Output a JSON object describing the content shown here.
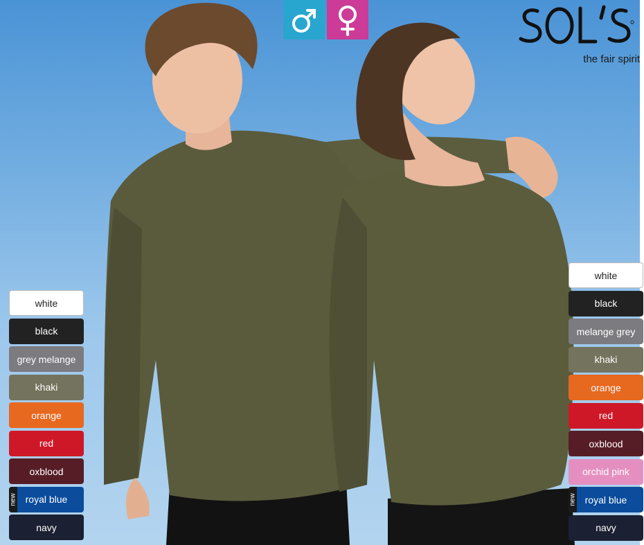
{
  "brand": {
    "logo_text": "SOL'S",
    "tagline": "the fair spirit"
  },
  "gender_icons": [
    {
      "name": "male",
      "icon": "male-symbol-icon",
      "color": "#29a6cf"
    },
    {
      "name": "female",
      "icon": "female-symbol-icon",
      "color": "#cb3b97"
    }
  ],
  "men_colors": [
    {
      "label": "white",
      "hex": "#ffffff",
      "light": true
    },
    {
      "label": "black",
      "hex": "#222222"
    },
    {
      "label": "grey melange",
      "hex": "#7c7b80"
    },
    {
      "label": "khaki",
      "hex": "#74735e"
    },
    {
      "label": "orange",
      "hex": "#e7681f"
    },
    {
      "label": "red",
      "hex": "#cf1827"
    },
    {
      "label": "oxblood",
      "hex": "#571d26"
    },
    {
      "label": "royal blue",
      "hex": "#0b4c9c",
      "new": true,
      "new_label": "new"
    },
    {
      "label": "navy",
      "hex": "#1c2033"
    }
  ],
  "women_colors": [
    {
      "label": "white",
      "hex": "#ffffff",
      "light": true
    },
    {
      "label": "black",
      "hex": "#222222"
    },
    {
      "label": "melange grey",
      "hex": "#7c7b80"
    },
    {
      "label": "khaki",
      "hex": "#74735e"
    },
    {
      "label": "orange",
      "hex": "#e7681f"
    },
    {
      "label": "red",
      "hex": "#cf1827"
    },
    {
      "label": "oxblood",
      "hex": "#571d26"
    },
    {
      "label": "orchid pink",
      "hex": "#e58fc0"
    },
    {
      "label": "royal blue",
      "hex": "#0b4c9c",
      "new": true,
      "new_label": "new"
    },
    {
      "label": "navy",
      "hex": "#1c2033"
    }
  ]
}
